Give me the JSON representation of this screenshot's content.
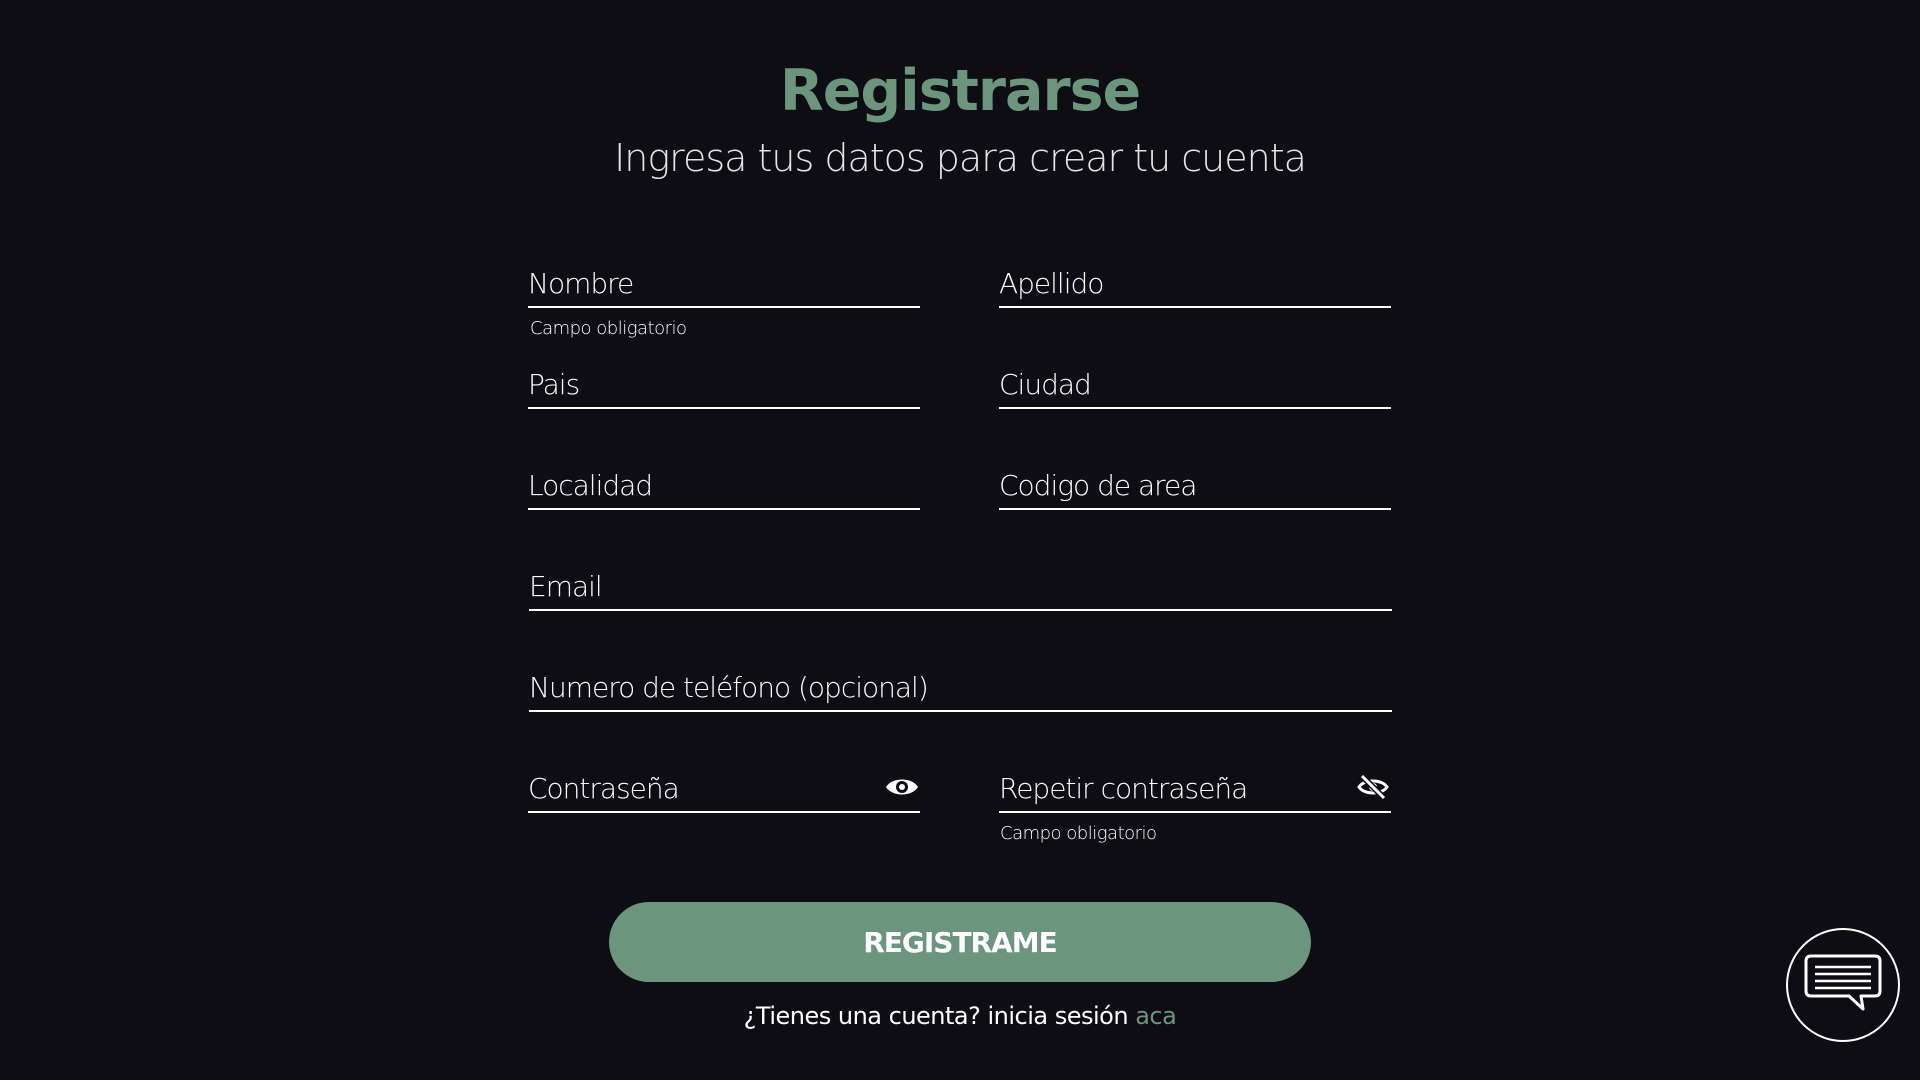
{
  "header": {
    "title": "Registrarse",
    "subtitle": "Ingresa tus datos para crear tu cuenta"
  },
  "form": {
    "nombre": {
      "placeholder": "Nombre",
      "value": "",
      "helper": "Campo obligatorio"
    },
    "apellido": {
      "placeholder": "Apellido",
      "value": ""
    },
    "pais": {
      "placeholder": "Pais",
      "value": ""
    },
    "ciudad": {
      "placeholder": "Ciudad",
      "value": ""
    },
    "localidad": {
      "placeholder": "Localidad",
      "value": ""
    },
    "codigo_area": {
      "placeholder": "Codigo de area",
      "value": ""
    },
    "email": {
      "placeholder": "Email",
      "value": ""
    },
    "telefono": {
      "placeholder": "Numero de teléfono (opcional)",
      "value": ""
    },
    "password": {
      "placeholder": "Contraseña",
      "value": "",
      "icon": "eye-icon"
    },
    "password_repeat": {
      "placeholder": "Repetir contraseña",
      "value": "",
      "icon": "eye-off-icon",
      "helper": "Campo obligatorio"
    },
    "submit_label": "REGISTRAME"
  },
  "footer": {
    "login_text": "¿Tienes una cuenta? inicia sesión",
    "login_link": "aca"
  },
  "chat": {
    "icon": "chat-icon"
  },
  "colors": {
    "background": "#0f0d14",
    "accent": "#6b957c",
    "text": "#ffffff"
  }
}
